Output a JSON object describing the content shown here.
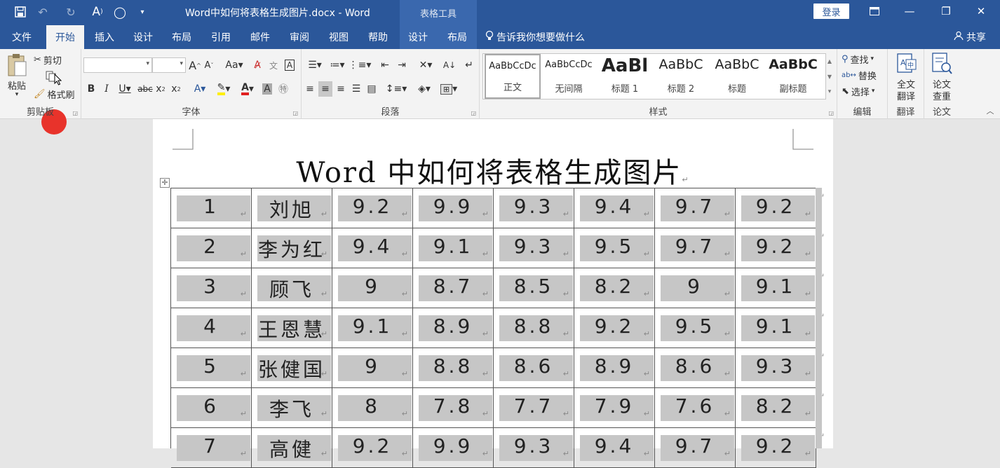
{
  "titlebar": {
    "doc_title": "Word中如何将表格生成图片.docx  -  Word",
    "tools_tab": "表格工具",
    "login": "登录"
  },
  "tabs": [
    "文件",
    "开始",
    "插入",
    "设计",
    "布局",
    "引用",
    "邮件",
    "审阅",
    "视图",
    "帮助",
    "设计",
    "布局"
  ],
  "active_tab": "开始",
  "tell_me": "告诉我你想要做什么",
  "share": "共享",
  "clipboard": {
    "paste": "粘贴",
    "cut": "剪切",
    "format_painter": "格式刷",
    "label": "剪贴板"
  },
  "font": {
    "label": "字体",
    "font_name": "",
    "font_size": ""
  },
  "paragraph": {
    "label": "段落"
  },
  "styles": {
    "label": "样式",
    "items": [
      {
        "sample": "AaBbCcDc",
        "name": "正文"
      },
      {
        "sample": "AaBbCcDc",
        "name": "无间隔"
      },
      {
        "sample": "AaBl",
        "name": "标题 1"
      },
      {
        "sample": "AaBbC",
        "name": "标题 2"
      },
      {
        "sample": "AaBbC",
        "name": "标题"
      },
      {
        "sample": "AaBbC",
        "name": "副标题"
      }
    ]
  },
  "editing": {
    "find": "查找",
    "replace": "替换",
    "select": "选择",
    "label": "编辑"
  },
  "translate": {
    "line1": "全文",
    "line2": "翻译",
    "label": "翻译"
  },
  "paper": {
    "line1": "论文",
    "line2": "查重",
    "label": "论文"
  },
  "document": {
    "title": "Word 中如何将表格生成图片",
    "table_rows": [
      [
        "1",
        "刘旭",
        "9.2",
        "9.9",
        "9.3",
        "9.4",
        "9.7",
        "9.2"
      ],
      [
        "2",
        "李为红",
        "9.4",
        "9.1",
        "9.3",
        "9.5",
        "9.7",
        "9.2"
      ],
      [
        "3",
        "顾飞",
        "9",
        "8.7",
        "8.5",
        "8.2",
        "9",
        "9.1"
      ],
      [
        "4",
        "王恩慧",
        "9.1",
        "8.9",
        "8.8",
        "9.2",
        "9.5",
        "9.1"
      ],
      [
        "5",
        "张健国",
        "9",
        "8.8",
        "8.6",
        "8.9",
        "8.6",
        "9.3"
      ],
      [
        "6",
        "李飞",
        "8",
        "7.8",
        "7.7",
        "7.9",
        "7.6",
        "8.2"
      ],
      [
        "7",
        "高健",
        "9.2",
        "9.9",
        "9.3",
        "9.4",
        "9.7",
        "9.2"
      ]
    ]
  },
  "colors": {
    "accent": "#2b579a",
    "ribbon": "#f3f3f3",
    "shade": "#c6c6c6"
  }
}
